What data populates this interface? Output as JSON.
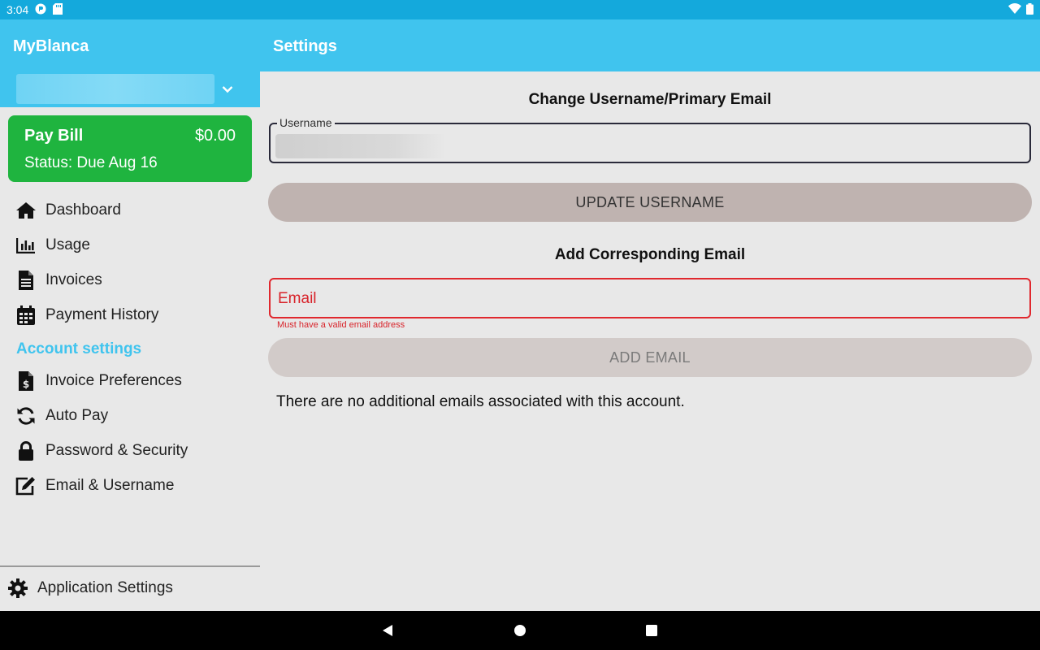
{
  "status_bar": {
    "time": "3:04"
  },
  "app": {
    "title": "MyBlanca",
    "page_title": "Settings"
  },
  "sidebar": {
    "pay_card": {
      "title": "Pay Bill",
      "amount": "$0.00",
      "status": "Status: Due Aug 16"
    },
    "items": [
      {
        "label": "Dashboard",
        "icon": "home-icon"
      },
      {
        "label": "Usage",
        "icon": "bar-chart-icon"
      },
      {
        "label": "Invoices",
        "icon": "document-icon"
      },
      {
        "label": "Payment History",
        "icon": "calendar-icon"
      }
    ],
    "section_title": "Account settings",
    "account_items": [
      {
        "label": "Invoice Preferences",
        "icon": "invoice-dollar-icon"
      },
      {
        "label": "Auto Pay",
        "icon": "sync-icon"
      },
      {
        "label": "Password & Security",
        "icon": "lock-icon"
      },
      {
        "label": "Email & Username",
        "icon": "edit-icon"
      }
    ],
    "footer": {
      "label": "Application Settings",
      "icon": "gear-icon"
    }
  },
  "main": {
    "username_section": {
      "heading": "Change Username/Primary Email",
      "field_label": "Username",
      "button_label": "UPDATE USERNAME"
    },
    "email_section": {
      "heading": "Add Corresponding Email",
      "placeholder": "Email",
      "error": "Must have a valid email address",
      "button_label": "ADD EMAIL",
      "empty_message": "There are no additional emails associated with this account."
    }
  },
  "colors": {
    "accent": "#40c4ee",
    "status_bar": "#14a9dc",
    "pay_card": "#1fb43f",
    "error": "#d8232a"
  }
}
